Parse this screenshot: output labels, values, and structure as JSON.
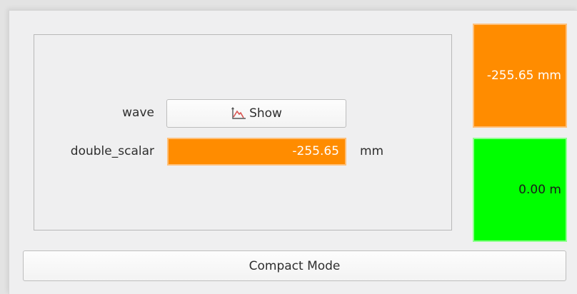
{
  "panel": {
    "wave_label": "wave",
    "show_button_label": "Show",
    "show_button_icon": "waveform-plot-icon",
    "scalar_label": "double_scalar",
    "scalar_value": "-255.65",
    "scalar_unit": "mm"
  },
  "indicators": {
    "primary_value": "-255.65 mm",
    "primary_color": "#ff8c00",
    "secondary_value": "0.00 m",
    "secondary_color": "#00ff00"
  },
  "footer": {
    "compact_mode_label": "Compact Mode"
  }
}
